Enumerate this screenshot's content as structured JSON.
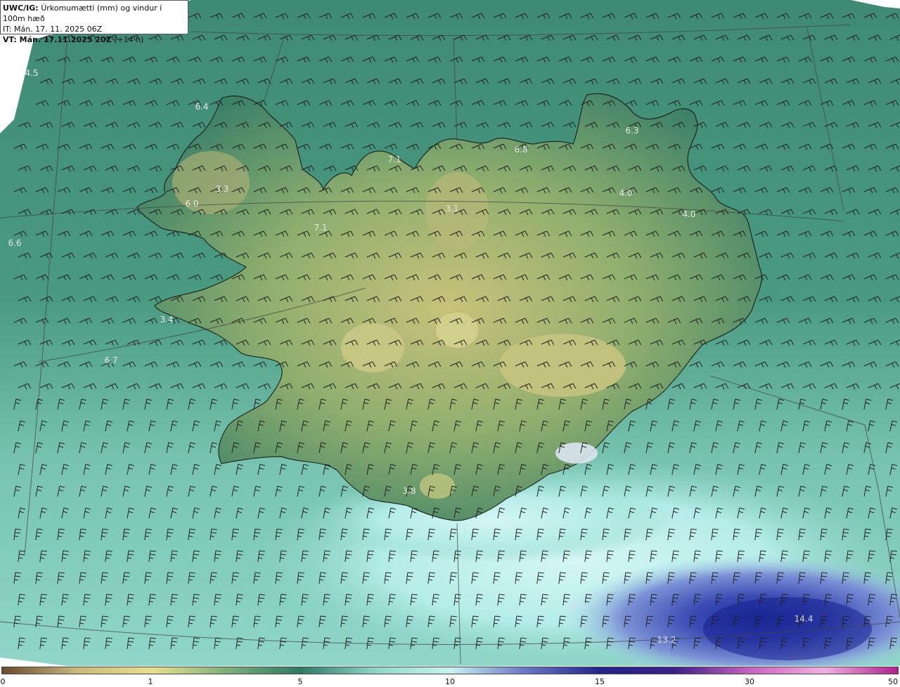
{
  "header": {
    "model": "UWC/IG:",
    "title": "Úrkomumætti (mm) og vindur í 100m hæð",
    "initial_time": "IT: Mán. 17. 11. 2025 06Z",
    "valid_label": "VT: Mán. 17.11.2025 20Z",
    "lead_time": "(+14 h)"
  },
  "colorbar": {
    "ticks": [
      "0",
      "1",
      "5",
      "10",
      "15",
      "30",
      "50"
    ],
    "colors": [
      "#6a4a2e",
      "#c9b87a",
      "#e8e08e",
      "#7fb07a",
      "#2e7a64",
      "#8fd6c8",
      "#c8f4f0",
      "#6a78c8",
      "#24248a",
      "#3a1f8a",
      "#c860c0",
      "#f0b0e0",
      "#b02090"
    ]
  },
  "map_labels": [
    {
      "text": "4.5"
    },
    {
      "text": "6.4"
    },
    {
      "text": "3.3"
    },
    {
      "text": "6.0"
    },
    {
      "text": "6.6"
    },
    {
      "text": "7.1"
    },
    {
      "text": "7.1"
    },
    {
      "text": "6.8"
    },
    {
      "text": "3.1"
    },
    {
      "text": "6.3"
    },
    {
      "text": "4.0"
    },
    {
      "text": "4.0"
    },
    {
      "text": "3.4"
    },
    {
      "text": "6.7"
    },
    {
      "text": "3.8"
    },
    {
      "text": "12.4"
    },
    {
      "text": "13.2"
    },
    {
      "text": "14.4"
    }
  ]
}
